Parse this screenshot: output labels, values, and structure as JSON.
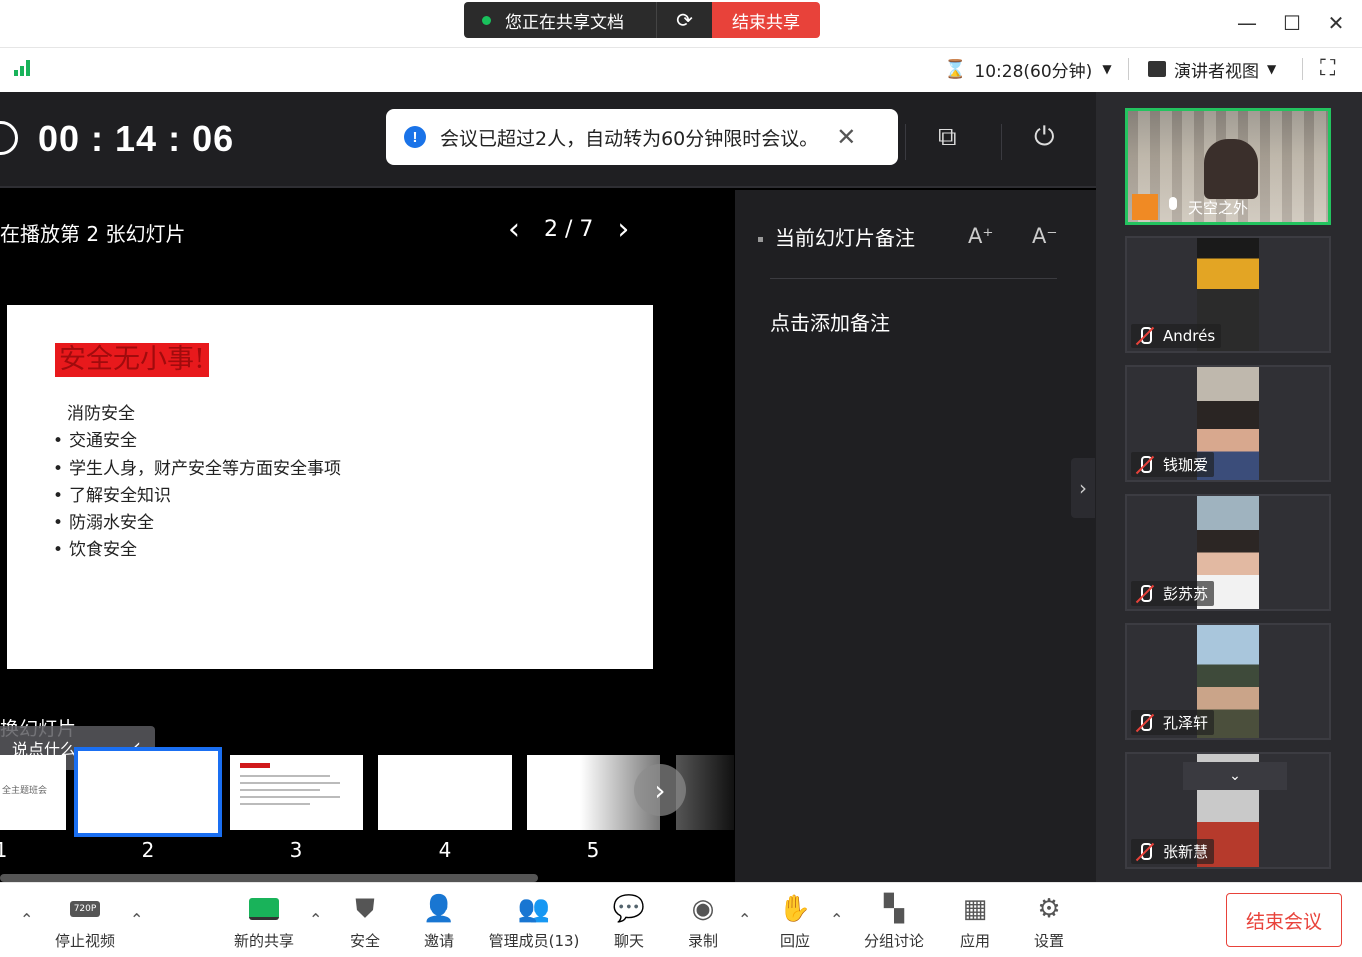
{
  "titlebar": {
    "share_status": "您正在共享文档",
    "stop_share": "结束共享"
  },
  "subheader": {
    "time_remaining": "10:28(60分钟)",
    "view_mode": "演讲者视图"
  },
  "presenter": {
    "elapsed": "00 : 14 : 06",
    "toast": "会议已超过2人，自动转为60分钟限时会议。",
    "playing_label": "在播放第 2 张幻灯片",
    "slide_counter": "2 / 7",
    "slide": {
      "title": "安全无小事!",
      "first_line": "消防安全",
      "bullets": [
        "交通安全",
        "学生人身，财产安全等方面安全事项",
        "了解安全知识",
        "防溺水安全",
        "饮食安全"
      ]
    },
    "switch_label": "换幻灯片",
    "say_tip": "说点什么...",
    "thumb1_text": "全主题班会",
    "thumb_numbers": [
      "1",
      "2",
      "3",
      "4",
      "5"
    ]
  },
  "notes": {
    "title": "当前幻灯片备注",
    "font_up": "A⁺",
    "font_down": "A⁻",
    "add": "点击添加备注"
  },
  "gallery": {
    "participants": [
      "天空之外",
      "Andrés",
      "钱珈爱",
      "彭苏苏",
      "孔泽轩",
      "张新慧"
    ],
    "colors": {
      "active_border": "#23c35f"
    }
  },
  "toolbar": {
    "video": "停止视频",
    "video_badge": "720P",
    "share": "新的共享",
    "security": "安全",
    "invite": "邀请",
    "members": "管理成员(13)",
    "chat": "聊天",
    "record": "录制",
    "reaction": "回应",
    "breakout": "分组讨论",
    "apps": "应用",
    "settings": "设置",
    "end": "结束会议"
  },
  "colors": {
    "accent": "#1a6ff2",
    "danger": "#e8423a",
    "signal": "#19b35a"
  }
}
